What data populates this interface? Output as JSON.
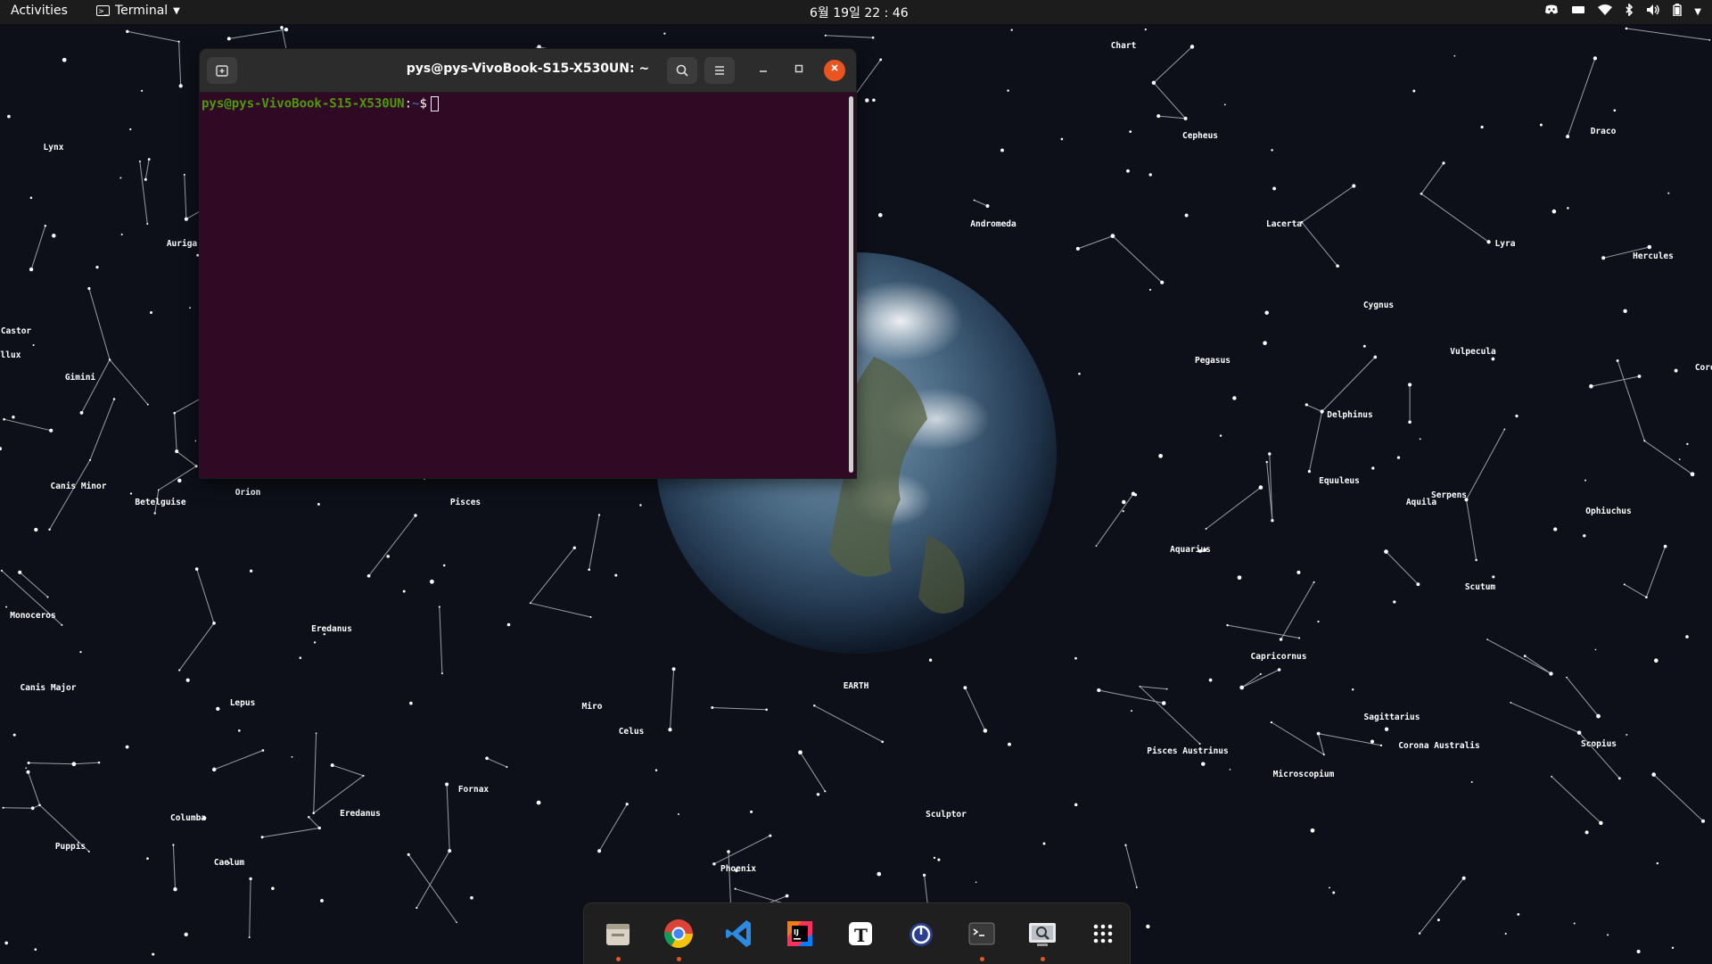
{
  "topbar": {
    "activities": "Activities",
    "app_name": "Terminal",
    "clock": "6월 19일 22 : 46",
    "tray_icons": [
      "discord-icon",
      "keyboard-icon",
      "wifi-icon",
      "bluetooth-icon",
      "volume-icon",
      "battery-icon",
      "system-menu-chevron-icon"
    ]
  },
  "terminal": {
    "title": "pys@pys-VivoBook-S15-X530UN: ~",
    "prompt_user": "pys@pys-VivoBook-S15-X530UN",
    "prompt_sep": ":",
    "prompt_path": "~",
    "prompt_symbol": "$",
    "buttons": {
      "new_tab": "new-tab-icon",
      "search": "search-icon",
      "menu": "hamburger-menu-icon",
      "minimize": "minimize-icon",
      "maximize": "maximize-icon",
      "close": "close-icon"
    }
  },
  "wallpaper": {
    "constellations": [
      "Chart",
      "Cepheus",
      "Draco",
      "Lynx",
      "Andromeda",
      "Lacerta",
      "Lyra",
      "Hercules",
      "Auriga",
      "Castor",
      "llux",
      "Gimini",
      "Cygnus",
      "Vulpecula",
      "Corona",
      "Pegasus",
      "Delphinus",
      "Canis Minor",
      "Betelguise",
      "Orion",
      "Pisces",
      "Equuleus",
      "Aquila",
      "Serpens",
      "Ophiuchus",
      "Monoceros",
      "Aquarius",
      "Scutum",
      "Eredanus",
      "Capricornus",
      "Canis Major",
      "Lepus",
      "Miro",
      "EARTH",
      "Celus",
      "Sagittarius",
      "Corona Australis",
      "Pisces Austrinus",
      "Scopius",
      "Microscopium",
      "Columba",
      "Eredanus",
      "Fornax",
      "Sculptor",
      "Puppis",
      "Caelum",
      "Phoenix"
    ]
  },
  "dock": {
    "apps": [
      {
        "name": "Files",
        "icon": "files-icon",
        "running": true
      },
      {
        "name": "Google Chrome",
        "icon": "chrome-icon",
        "running": true
      },
      {
        "name": "Visual Studio Code",
        "icon": "vscode-icon",
        "running": false
      },
      {
        "name": "IntelliJ IDEA",
        "icon": "intellij-icon",
        "running": false
      },
      {
        "name": "Typora",
        "icon": "typora-icon",
        "running": false
      },
      {
        "name": "Timer",
        "icon": "timer-icon",
        "running": false
      },
      {
        "name": "Terminal",
        "icon": "terminal-icon",
        "running": true
      },
      {
        "name": "Screenshot",
        "icon": "screenshot-icon",
        "running": true
      },
      {
        "name": "Show Applications",
        "icon": "app-grid-icon",
        "running": false
      }
    ]
  },
  "colors": {
    "terminal_bg": "#300a24",
    "accent": "#e95420",
    "prompt_user": "#4e9a06",
    "prompt_path": "#3465a4"
  }
}
